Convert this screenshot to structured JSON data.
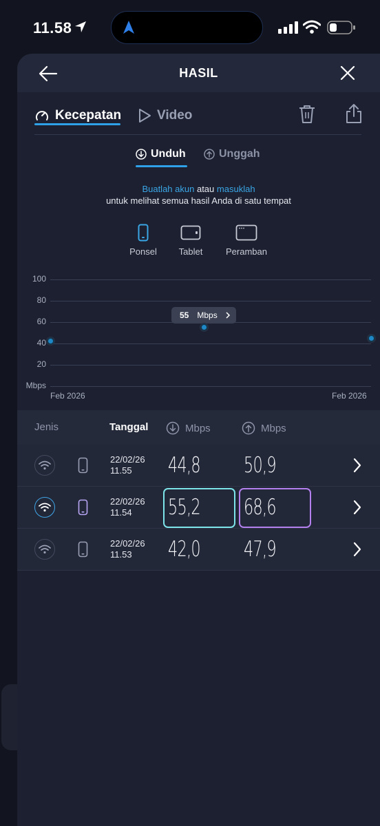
{
  "status_bar": {
    "time": "11.58"
  },
  "header": {
    "title": "HASIL"
  },
  "tabs": {
    "speed": "Kecepatan",
    "video": "Video"
  },
  "subtabs": {
    "download": "Unduh",
    "upload": "Unggah"
  },
  "promo": {
    "create_account": "Buatlah akun",
    "or": "atau",
    "login": "masuklah",
    "line2": "untuk melihat semua hasil Anda di satu tempat"
  },
  "devices": {
    "phone": "Ponsel",
    "tablet": "Tablet",
    "browser": "Peramban"
  },
  "chart_data": {
    "type": "scatter",
    "ylabel": "Mbps",
    "yticks": [
      "100",
      "80",
      "60",
      "40",
      "20"
    ],
    "ylim": [
      0,
      100
    ],
    "x_start_label": "Feb 2026",
    "x_end_label": "Feb 2026",
    "points": [
      {
        "x": 1,
        "y": 42
      },
      {
        "x": 2,
        "y": 55
      },
      {
        "x": 3,
        "y": 45
      }
    ],
    "tooltip": {
      "value": "55",
      "unit": "Mbps"
    },
    "grid": true,
    "dot_color": "#1e88c7"
  },
  "table": {
    "headers": {
      "type": "Jenis",
      "date": "Tanggal",
      "down": "Mbps",
      "up": "Mbps"
    },
    "rows": [
      {
        "date": "22/02/26",
        "time": "11.55",
        "down": "44,8",
        "up": "50,9",
        "highlighted": false
      },
      {
        "date": "22/02/26",
        "time": "11.54",
        "down": "55,2",
        "up": "68,6",
        "highlighted": true
      },
      {
        "date": "22/02/26",
        "time": "11.53",
        "down": "42,0",
        "up": "47,9",
        "highlighted": false
      }
    ]
  },
  "colors": {
    "accent": "#2ea1e8",
    "download_highlight": "#7de4ea",
    "upload_highlight": "#b380ee",
    "sheet_bg": "#1c2030"
  }
}
